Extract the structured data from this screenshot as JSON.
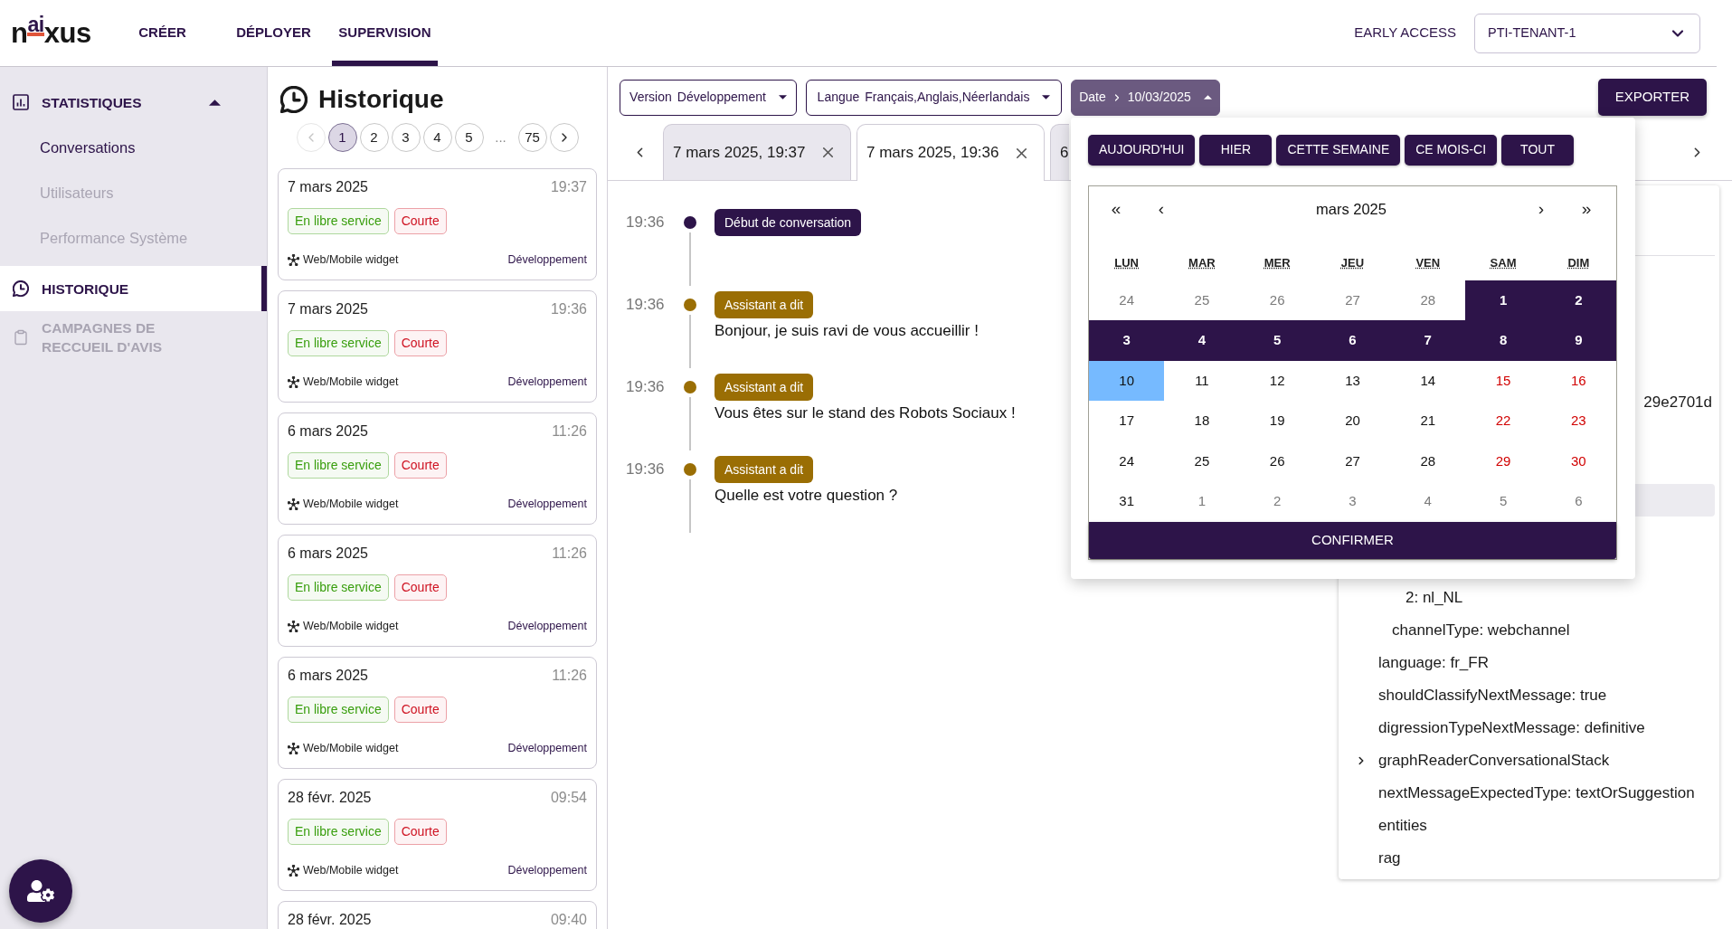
{
  "header": {
    "logo": "n$^{ai}$xus",
    "nav": [
      {
        "label": "CRÉER",
        "selected": false
      },
      {
        "label": "DÉPLOYER",
        "selected": false
      },
      {
        "label": "SUPERVISION",
        "selected": true
      }
    ],
    "early_access": "EARLY ACCESS",
    "tenant_select": {
      "value": "PTI-TENANT-1"
    }
  },
  "sidebar": {
    "items": [
      {
        "label": "STATISTIQUES",
        "selected": false,
        "disabled": false,
        "expanded": true,
        "children": [
          {
            "label": "Conversations",
            "selected": false,
            "disabled": false
          },
          {
            "label": "Utilisateurs",
            "selected": false,
            "disabled": true
          },
          {
            "label": "Performance Système",
            "selected": false,
            "disabled": true
          }
        ]
      },
      {
        "label": "HISTORIQUE",
        "selected": true,
        "disabled": false
      },
      {
        "label": "CAMPAGNES DE RECCUEIL D'AVIS",
        "selected": false,
        "disabled": true
      }
    ]
  },
  "history": {
    "title": "Historique",
    "pagination": {
      "prev": {
        "disabled": true
      },
      "next": {
        "disabled": false
      },
      "pages": [
        {
          "kind": "page",
          "label": "1",
          "selected": true
        },
        {
          "kind": "page",
          "label": "2",
          "selected": false
        },
        {
          "kind": "page",
          "label": "3",
          "selected": false
        },
        {
          "kind": "page",
          "label": "4",
          "selected": false
        },
        {
          "kind": "page",
          "label": "5",
          "selected": false
        },
        {
          "kind": "ellipsis",
          "label": "..."
        },
        {
          "kind": "page",
          "label": "75",
          "selected": false
        }
      ]
    },
    "cards": [
      {
        "date": "7 mars 2025",
        "time": "19:37",
        "tags": [
          {
            "label": "En libre service",
            "color": "#389e0d"
          },
          {
            "label": "Courte",
            "color": "#cf1322"
          }
        ],
        "channel": "Web/Mobile widget",
        "version": "Développement"
      },
      {
        "date": "7 mars 2025",
        "time": "19:36",
        "tags": [
          {
            "label": "En libre service",
            "color": "#389e0d"
          },
          {
            "label": "Courte",
            "color": "#cf1322"
          }
        ],
        "channel": "Web/Mobile widget",
        "version": "Développement"
      },
      {
        "date": "6 mars 2025",
        "time": "11:26",
        "tags": [
          {
            "label": "En libre service",
            "color": "#389e0d"
          },
          {
            "label": "Courte",
            "color": "#cf1322"
          }
        ],
        "channel": "Web/Mobile widget",
        "version": "Développement"
      },
      {
        "date": "6 mars 2025",
        "time": "11:26",
        "tags": [
          {
            "label": "En libre service",
            "color": "#389e0d"
          },
          {
            "label": "Courte",
            "color": "#cf1322"
          }
        ],
        "channel": "Web/Mobile widget",
        "version": "Développement"
      },
      {
        "date": "6 mars 2025",
        "time": "11:26",
        "tags": [
          {
            "label": "En libre service",
            "color": "#389e0d"
          },
          {
            "label": "Courte",
            "color": "#cf1322"
          }
        ],
        "channel": "Web/Mobile widget",
        "version": "Développement"
      },
      {
        "date": "28 févr. 2025",
        "time": "09:54",
        "tags": [
          {
            "label": "En libre service",
            "color": "#389e0d"
          },
          {
            "label": "Courte",
            "color": "#cf1322"
          }
        ],
        "channel": "Web/Mobile widget",
        "version": "Développement"
      },
      {
        "date": "28 févr. 2025",
        "time": "09:40"
      }
    ]
  },
  "filters": [
    {
      "kind": "select",
      "label": "Version",
      "value": "Développement",
      "open": false
    },
    {
      "kind": "select",
      "label": "Langue",
      "value": "Français,Anglais,Néerlandais",
      "open": false
    },
    {
      "kind": "date",
      "label": "Date",
      "value": "10/03/2025",
      "open": true
    }
  ],
  "export_button": "EXPORTER",
  "date_picker": {
    "presets": [
      "AUJOURD'HUI",
      "HIER",
      "CETTE SEMAINE",
      "CE MOIS-CI",
      "TOUT"
    ],
    "nav": {
      "prev_year": "«",
      "prev_month": "‹",
      "next_month": "›",
      "next_year": "»"
    },
    "month": "mars 2025",
    "weekdays": [
      "LUN",
      "MAR",
      "MER",
      "JEU",
      "VEN",
      "SAM",
      "DIM"
    ],
    "days": [
      {
        "label": "24",
        "kind": "other",
        "selected": false,
        "highlighted": false
      },
      {
        "label": "25",
        "kind": "other",
        "selected": false,
        "highlighted": false
      },
      {
        "label": "26",
        "kind": "other",
        "selected": false,
        "highlighted": false
      },
      {
        "label": "27",
        "kind": "other",
        "selected": false,
        "highlighted": false
      },
      {
        "label": "28",
        "kind": "other",
        "selected": false,
        "highlighted": false
      },
      {
        "label": "1",
        "kind": "weekend",
        "selected": true,
        "highlighted": false
      },
      {
        "label": "2",
        "kind": "weekend",
        "selected": true,
        "highlighted": false
      },
      {
        "label": "3",
        "kind": "weekday",
        "selected": true,
        "highlighted": false
      },
      {
        "label": "4",
        "kind": "weekday",
        "selected": true,
        "highlighted": false
      },
      {
        "label": "5",
        "kind": "weekday",
        "selected": true,
        "highlighted": false
      },
      {
        "label": "6",
        "kind": "weekday",
        "selected": true,
        "highlighted": false
      },
      {
        "label": "7",
        "kind": "weekday",
        "selected": true,
        "highlighted": false
      },
      {
        "label": "8",
        "kind": "weekend",
        "selected": true,
        "highlighted": false
      },
      {
        "label": "9",
        "kind": "weekend",
        "selected": true,
        "highlighted": false
      },
      {
        "label": "10",
        "kind": "weekday",
        "selected": false,
        "highlighted": true
      },
      {
        "label": "11",
        "kind": "weekday",
        "selected": false,
        "highlighted": false
      },
      {
        "label": "12",
        "kind": "weekday",
        "selected": false,
        "highlighted": false
      },
      {
        "label": "13",
        "kind": "weekday",
        "selected": false,
        "highlighted": false
      },
      {
        "label": "14",
        "kind": "weekday",
        "selected": false,
        "highlighted": false
      },
      {
        "label": "15",
        "kind": "weekend",
        "selected": false,
        "highlighted": false
      },
      {
        "label": "16",
        "kind": "weekend",
        "selected": false,
        "highlighted": false
      },
      {
        "label": "17",
        "kind": "weekday",
        "selected": false,
        "highlighted": false
      },
      {
        "label": "18",
        "kind": "weekday",
        "selected": false,
        "highlighted": false
      },
      {
        "label": "19",
        "kind": "weekday",
        "selected": false,
        "highlighted": false
      },
      {
        "label": "20",
        "kind": "weekday",
        "selected": false,
        "highlighted": false
      },
      {
        "label": "21",
        "kind": "weekday",
        "selected": false,
        "highlighted": false
      },
      {
        "label": "22",
        "kind": "weekend",
        "selected": false,
        "highlighted": false
      },
      {
        "label": "23",
        "kind": "weekend",
        "selected": false,
        "highlighted": false
      },
      {
        "label": "24",
        "kind": "weekday",
        "selected": false,
        "highlighted": false
      },
      {
        "label": "25",
        "kind": "weekday",
        "selected": false,
        "highlighted": false
      },
      {
        "label": "26",
        "kind": "weekday",
        "selected": false,
        "highlighted": false
      },
      {
        "label": "27",
        "kind": "weekday",
        "selected": false,
        "highlighted": false
      },
      {
        "label": "28",
        "kind": "weekday",
        "selected": false,
        "highlighted": false
      },
      {
        "label": "29",
        "kind": "weekend",
        "selected": false,
        "highlighted": false
      },
      {
        "label": "30",
        "kind": "weekend",
        "selected": false,
        "highlighted": false
      },
      {
        "label": "31",
        "kind": "weekday",
        "selected": false,
        "highlighted": false
      },
      {
        "label": "1",
        "kind": "other",
        "selected": false,
        "highlighted": false
      },
      {
        "label": "2",
        "kind": "other",
        "selected": false,
        "highlighted": false
      },
      {
        "label": "3",
        "kind": "other",
        "selected": false,
        "highlighted": false
      },
      {
        "label": "4",
        "kind": "other",
        "selected": false,
        "highlighted": false
      },
      {
        "label": "5",
        "kind": "other",
        "selected": false,
        "highlighted": false
      },
      {
        "label": "6",
        "kind": "other",
        "selected": false,
        "highlighted": false
      }
    ],
    "confirm": "CONFIRMER"
  },
  "tabs": [
    {
      "label": "7 mars 2025, 19:37",
      "selected": false,
      "closable": true
    },
    {
      "label": "7 mars 2025, 19:36",
      "selected": true,
      "closable": true
    },
    {
      "label": "6",
      "selected": false,
      "closable": false
    }
  ],
  "timeline": [
    {
      "time": "19:36",
      "kind": "start",
      "badge": "Début de conversation"
    },
    {
      "time": "19:36",
      "kind": "assistant",
      "badge": "Assistant a dit",
      "message": "Bonjour, je suis ravi de vous accueillir !"
    },
    {
      "time": "19:36",
      "kind": "assistant",
      "badge": "Assistant a dit",
      "message": "Vous êtes sur le stand des Robots Sociaux !"
    },
    {
      "time": "19:36",
      "kind": "assistant",
      "badge": "Assistant a dit",
      "message": "Quelle est votre question ?"
    }
  ],
  "details_panel": {
    "id_tail": "29e2701d",
    "highlighted_row": true,
    "tree": [
      {
        "children": [
          {
            "children": [
              {
                "label": "2: nl_NL",
                "kind": "leaf"
              }
            ]
          },
          {
            "label": "channelType: webchannel",
            "kind": "leaf"
          }
        ]
      },
      {
        "label": "language: fr_FR",
        "kind": "leaf"
      },
      {
        "label": "shouldClassifyNextMessage: true",
        "kind": "leaf"
      },
      {
        "label": "digressionTypeNextMessage: definitive",
        "kind": "leaf"
      },
      {
        "label": "graphReaderConversationalStack",
        "kind": "branch",
        "expanded": false
      },
      {
        "label": "nextMessageExpectedType: textOrSuggestion",
        "kind": "leaf"
      },
      {
        "label": "entities",
        "kind": "leaf"
      },
      {
        "label": "rag",
        "kind": "leaf"
      }
    ]
  }
}
